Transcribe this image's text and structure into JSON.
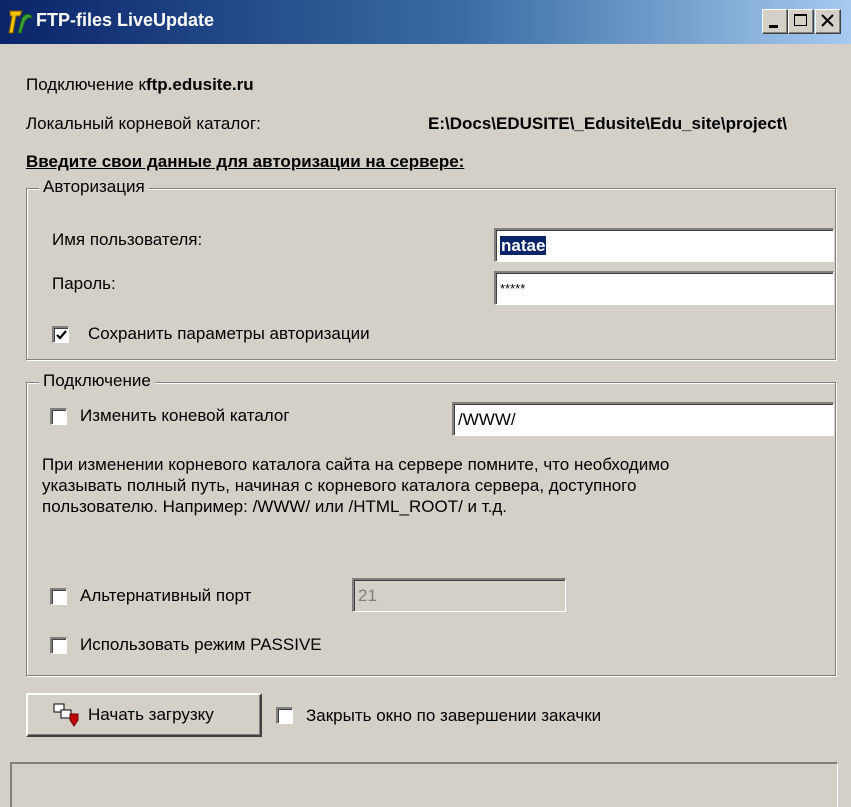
{
  "window": {
    "title": "FTP-files LiveUpdate",
    "caption_buttons": [
      "minimize-icon",
      "maximize-icon",
      "close-icon"
    ]
  },
  "info": {
    "connection_prefix": "Подключение к",
    "connection_host": "ftp.edusite.ru",
    "local_root_label": "Локальный корневой каталог:",
    "local_root_value": "E:\\Docs\\EDUSITE\\_Edusite\\Edu_site\\project\\"
  },
  "heading": "Введите свои данные для авторизации на сервере:",
  "auth": {
    "group_title": "Авторизация",
    "username_label": "Имя пользователя:",
    "username_value": "natae",
    "password_label": "Пароль:",
    "password_value": "*****",
    "save_label": "Сохранить параметры авторизации",
    "save_checked": true
  },
  "connection": {
    "group_title": "Подключение",
    "change_root_label": "Изменить коневой каталог",
    "change_root_checked": false,
    "root_value": "/WWW/",
    "hint_lines": [
      "При изменении корневого каталога сайта на сервере помните, что необходимо",
      "указывать полный путь, начиная с корневого каталога сервера, доступного",
      "пользователю. Например: /WWW/ или /HTML_ROOT/ и т.д."
    ],
    "alt_port_label": "Альтернативный порт",
    "alt_port_checked": false,
    "alt_port_value": "21",
    "passive_label": "Использовать режим PASSIVE",
    "passive_checked": false
  },
  "actions": {
    "start_label": "Начать загрузку",
    "close_on_finish_label": "Закрыть окно по завершении закачки",
    "close_on_finish_checked": false
  },
  "status": {
    "text": ""
  }
}
